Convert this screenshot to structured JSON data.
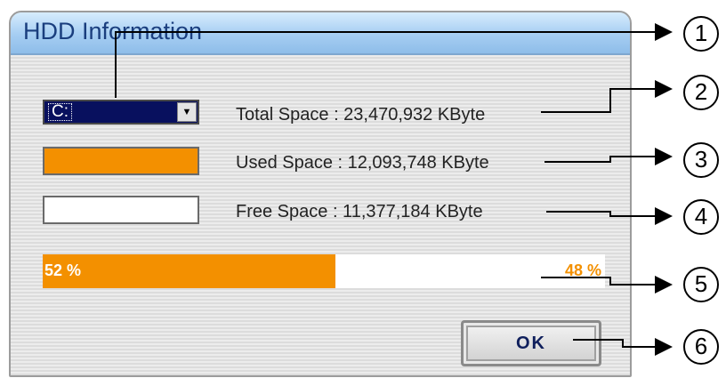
{
  "dialog": {
    "title": "HDD Information",
    "drive_select": {
      "value": "C:",
      "arrow_icon": "chevron-down-icon"
    },
    "total_space": "Total Space : 23,470,932  KByte",
    "used_space": "Used Space : 12,093,748  KByte",
    "free_space": "Free Space : 11,377,184  KByte",
    "usage": {
      "used_fraction": 0.52,
      "used_label": "52 %",
      "free_label": "48 %"
    },
    "ok_label": "OK"
  },
  "callouts": [
    "1",
    "2",
    "3",
    "4",
    "5",
    "6"
  ],
  "colors": {
    "used": "#f39000",
    "free": "#ffffff",
    "select_bg": "#08105e",
    "title_text": "#1a3e7e"
  }
}
